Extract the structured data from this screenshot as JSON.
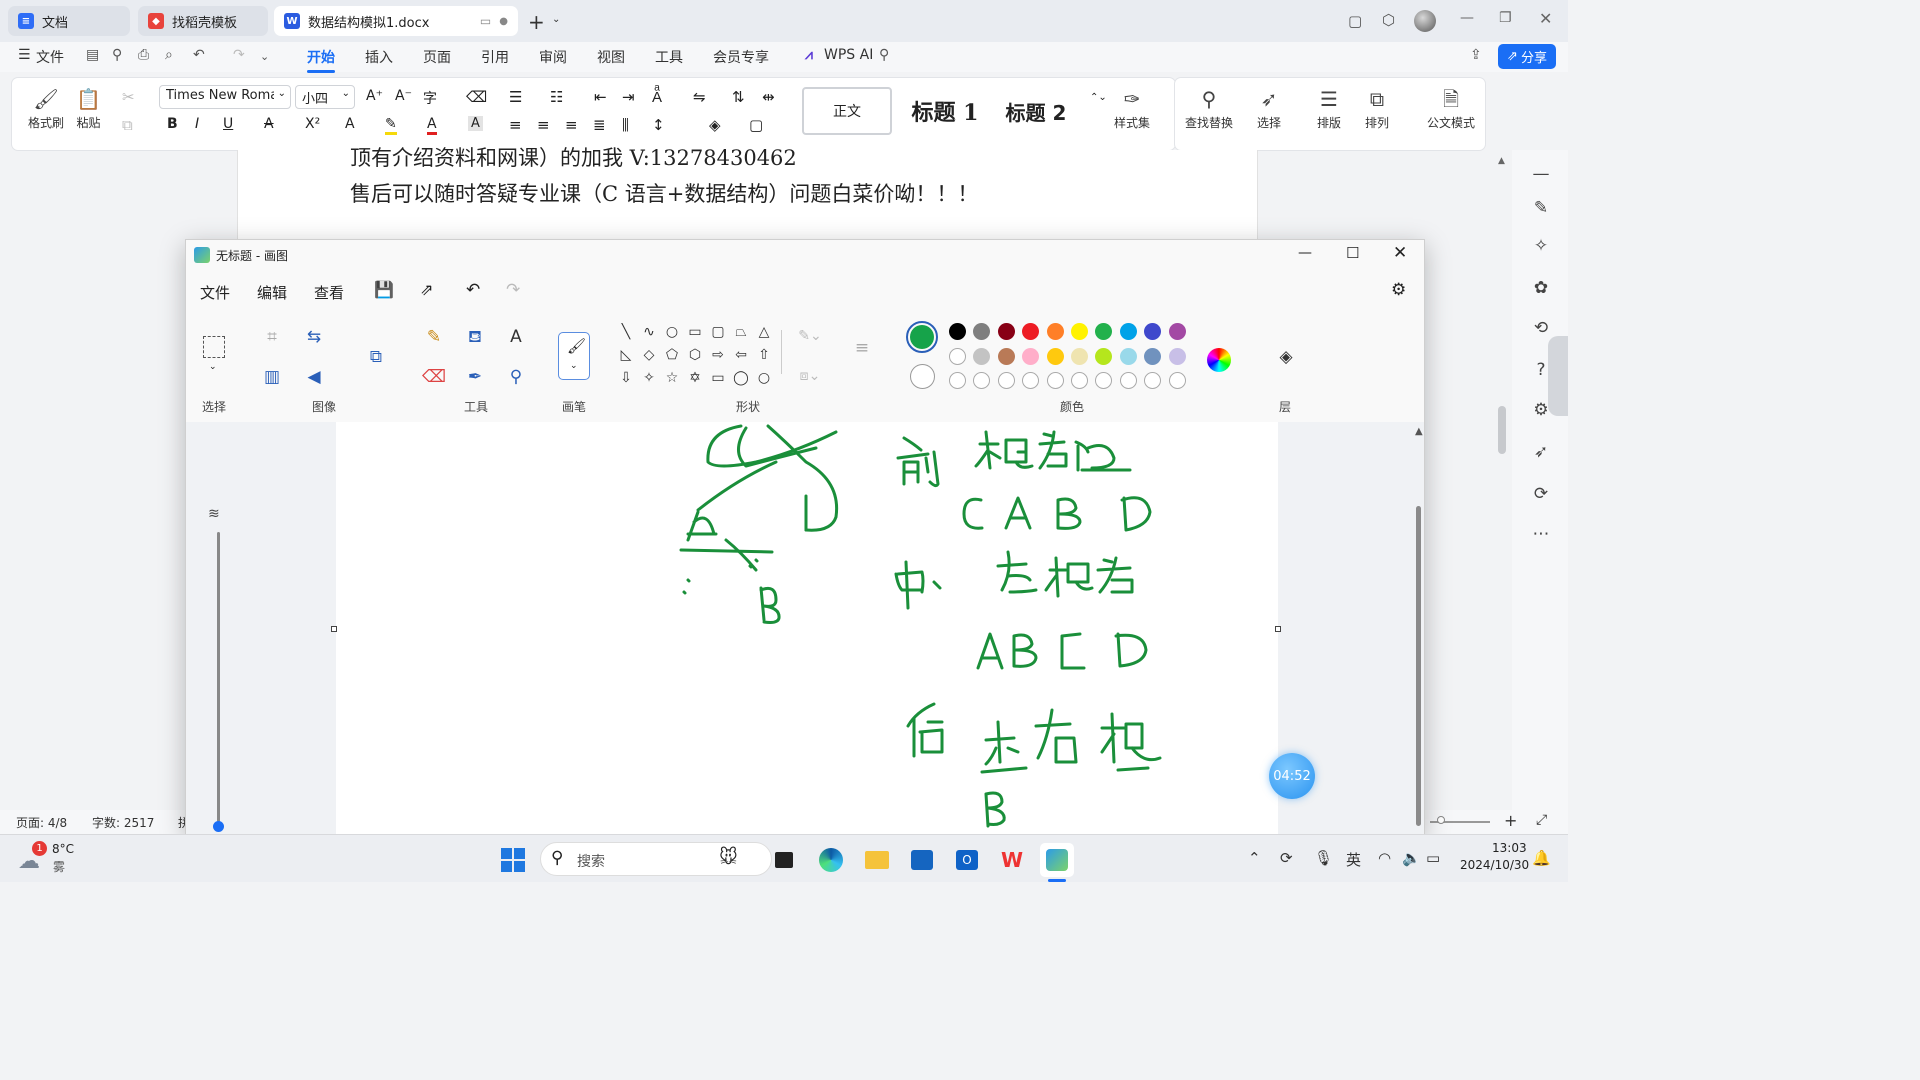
{
  "wps": {
    "tabs": [
      {
        "label": "文档"
      },
      {
        "label": "找稻壳模板"
      },
      {
        "label": "数据结构模拟1.docx"
      }
    ],
    "menu_file": "文件",
    "menu": [
      "开始",
      "插入",
      "页面",
      "引用",
      "审阅",
      "视图",
      "工具",
      "会员专享"
    ],
    "wps_ai": "WPS AI",
    "share": "分享",
    "ribbon": {
      "format_painter": "格式刷",
      "paste": "粘贴",
      "font_name": "Times New Roman",
      "font_size": "小四",
      "style_normal": "正文",
      "style_h1": "标题 1",
      "style_h2": "标题 2",
      "style_set": "样式集",
      "find_replace": "查找替换",
      "select": "选择",
      "layout": "排版",
      "arrange": "排列",
      "official_mode": "公文模式"
    },
    "doc_lines": [
      "顶有介绍资料和网课）的加我 V:13278430462",
      "售后可以随时答疑专业课（C 语言+数据结构）问题白菜价呦！！！"
    ],
    "status": {
      "page": "页面: 4/8",
      "words": "字数: 2517",
      "cut": "拼"
    }
  },
  "paint": {
    "title": "无标题 - 画图",
    "menu": [
      "文件",
      "编辑",
      "查看"
    ],
    "groups": {
      "select": "选择",
      "image": "图像",
      "tools": "工具",
      "brushes": "画笔",
      "shapes": "形状",
      "colors": "颜色",
      "layers": "层"
    },
    "colors": {
      "current": "#16a34a",
      "row1": [
        "#000000",
        "#7f7f7f",
        "#880015",
        "#ed1c24",
        "#ff7f27",
        "#fff200",
        "#22b14c",
        "#00a2e8",
        "#3f48cc",
        "#a349a4"
      ],
      "row2": [
        "#ffffff",
        "#c3c3c3",
        "#b97a57",
        "#ffaec9",
        "#ffc90e",
        "#efe4b0",
        "#b5e61d",
        "#99d9ea",
        "#7092be",
        "#c8bfe7"
      ]
    },
    "ink_color": "#1a8f3a",
    "timer": "04:52"
  },
  "taskbar": {
    "weather_temp": "8°C",
    "weather_desc": "雾",
    "weather_badge": "1",
    "search": "搜索",
    "time": "13:03",
    "date": "2024/10/30",
    "ime": "英"
  }
}
